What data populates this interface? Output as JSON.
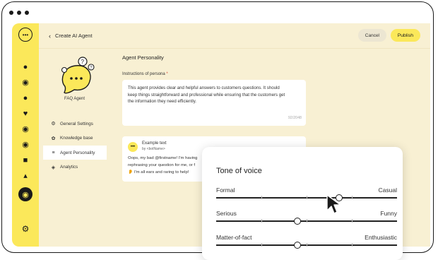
{
  "header": {
    "back_label": "Create AI Agent",
    "cancel_label": "Cancel",
    "publish_label": "Publish",
    "accent_color": "#fbe85a"
  },
  "sidebar": {
    "icons": [
      "chat-icon",
      "chats-icon",
      "users-icon",
      "handshake-icon",
      "messenger-icon",
      "whatsapp-icon",
      "bag-icon",
      "chart-icon",
      "agent-icon",
      "settings-icon"
    ]
  },
  "agent": {
    "name": "FAQ Agent"
  },
  "nav": {
    "items": [
      {
        "label": "General Settings",
        "icon": "gear-icon"
      },
      {
        "label": "Knowledge base",
        "icon": "brain-icon"
      },
      {
        "label": "Agent Personality",
        "icon": "sliders-icon"
      },
      {
        "label": "Analytics",
        "icon": "cube-icon"
      }
    ]
  },
  "main": {
    "section_title": "Agent Personality",
    "instructions_label": "Instructions of persona",
    "required_mark": "*",
    "instructions_line1": "This agent provides clear and helpful answers to customers questions. It should",
    "instructions_line2": "keep things straightforward and professional while ensuring that the customers get",
    "instructions_line3": "the information they need efficiently.",
    "counter": "92/2048",
    "example_title": "Example text",
    "example_sub": "by <botName>",
    "example_line1": "Oops, my bad @firstname! I'm having",
    "example_line2": "rephrasing your question for me, or f",
    "example_line3": "I'm all ears and raring to help!"
  },
  "tone": {
    "title": "Tone of voice",
    "sliders": [
      {
        "left": "Formal",
        "right": "Casual",
        "value": 0.68
      },
      {
        "left": "Serious",
        "right": "Funny",
        "value": 0.45
      },
      {
        "left": "Matter-of-fact",
        "right": "Enthusiastic",
        "value": 0.45
      }
    ]
  }
}
